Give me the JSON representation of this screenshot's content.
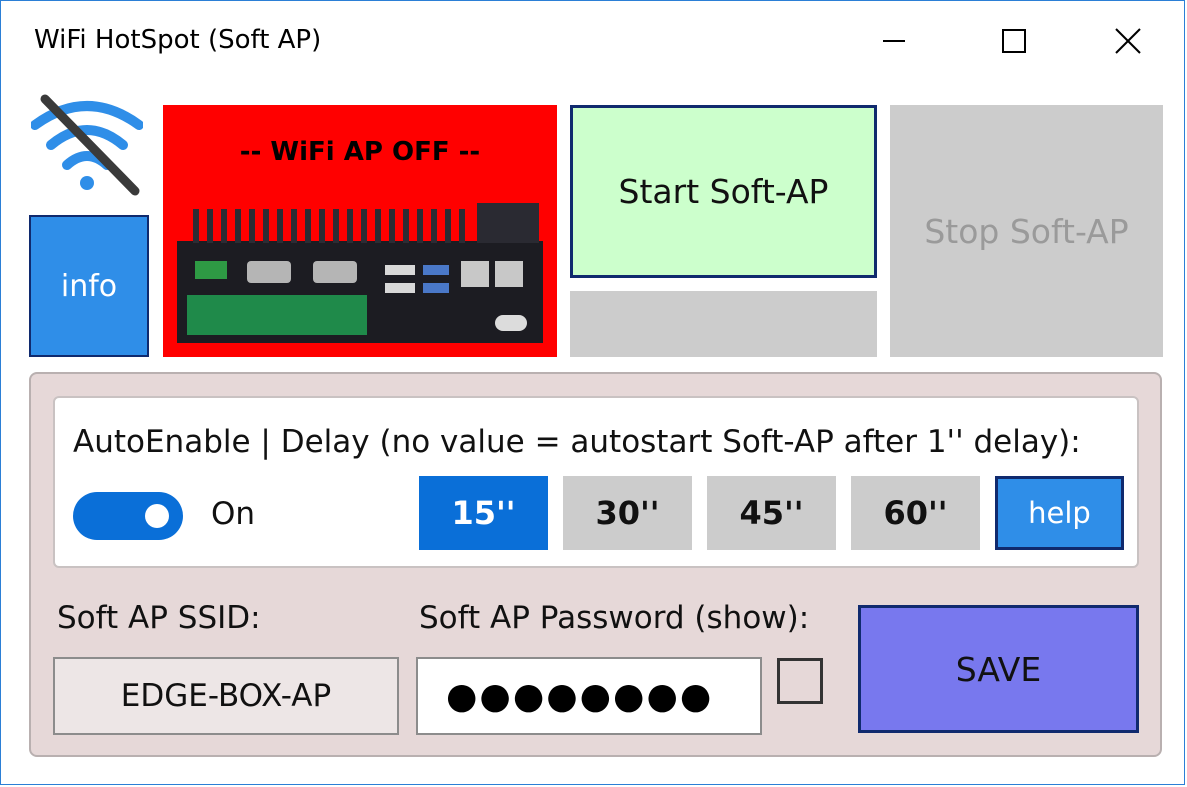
{
  "window": {
    "title": "WiFi HotSpot (Soft AP)",
    "controls": [
      "minimize",
      "maximize",
      "close"
    ]
  },
  "status": {
    "wifi_icon": "wifi-off-icon",
    "text": "-- WiFi AP OFF --",
    "panel_color": "#ff0000",
    "device_image": "edge-box-device"
  },
  "buttons": {
    "info": "info",
    "start": "Start Soft-AP",
    "stop": "Stop Soft-AP",
    "start_color": "#ccffcc",
    "stop_enabled": false
  },
  "auto_enable": {
    "label": "AutoEnable | Delay (no value = autostart Soft-AP after 1'' delay):",
    "toggle_state": "On",
    "toggle_on": true,
    "delays": [
      {
        "label": "15''",
        "active": true
      },
      {
        "label": "30''",
        "active": false
      },
      {
        "label": "45''",
        "active": false
      },
      {
        "label": "60''",
        "active": false
      }
    ],
    "help_label": "help"
  },
  "ssid": {
    "label": "Soft AP SSID:",
    "value": "EDGE-BOX-AP"
  },
  "password": {
    "label": "Soft AP Password (show):",
    "masked_value": "●●●●●●●●",
    "show_checked": false
  },
  "save": {
    "label": "SAVE",
    "color": "#7878ee"
  },
  "colors": {
    "accent_blue": "#0a6fd8",
    "info_blue": "#2f8ee8",
    "border_navy": "#102a6e",
    "settings_bg": "#e6d8d8"
  }
}
